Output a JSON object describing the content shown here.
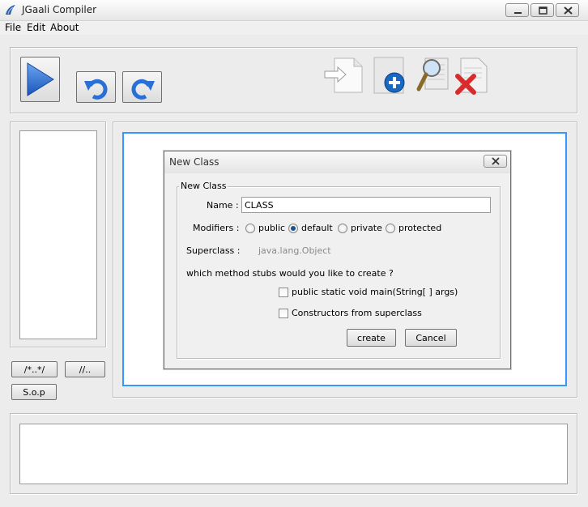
{
  "window": {
    "title": "JGaali Compiler",
    "controls": {
      "minimize": "minimize",
      "maximize": "maximize",
      "close": "close"
    }
  },
  "menu": {
    "items": [
      "File",
      "Edit",
      "About"
    ]
  },
  "toolbar": {
    "run_icon": "play-icon",
    "undo_icon": "undo-icon",
    "redo_icon": "redo-icon",
    "new_file_icon": "new-file-icon",
    "add_icon": "add-document-icon",
    "search_icon": "magnifier-document-icon",
    "delete_icon": "delete-document-icon"
  },
  "snippets": {
    "block_comment": "/*..*/",
    "line_comment": "//..",
    "sop": "S.o.p"
  },
  "dialog": {
    "title": "New Class",
    "group_label": "New Class",
    "name_label": "Name :",
    "name_value": "CLASS",
    "modifiers_label": "Modifiers :",
    "modifiers": [
      "public",
      "default",
      "private",
      "protected"
    ],
    "selected_modifier": "default",
    "superclass_label": "Superclass :",
    "superclass_value": "java.lang.Object",
    "stubs_question": "which method stubs would you like to create ?",
    "stub_main": "public static void main(String[ ] args)",
    "stub_ctor": "Constructors from superclass",
    "create_label": "create",
    "cancel_label": "Cancel"
  },
  "colors": {
    "accent_border": "#3399ff",
    "play_blue": "#2a6fd6",
    "delete_red": "#d92b2b",
    "add_blue": "#1769c4"
  }
}
